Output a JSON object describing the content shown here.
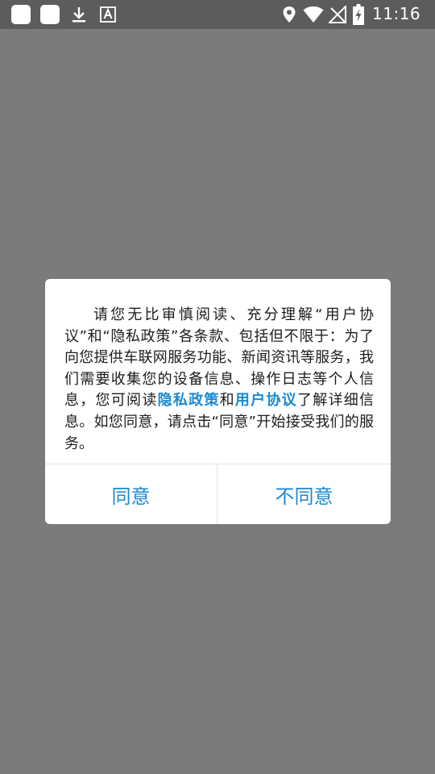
{
  "status_bar": {
    "time": "11:16",
    "notification_icons": [
      "app-square-icon",
      "app-square-icon",
      "download-icon",
      "accessibility-text-icon"
    ],
    "system_icons": [
      "location-icon",
      "wifi-icon",
      "no-signal-icon",
      "battery-charging-icon"
    ]
  },
  "dialog": {
    "body": {
      "text1": "请您无比审慎阅读、充分理解“用户协议”和“隐私政策”各条款、包括但不限于：为了向您提供车联网服务功能、新闻资讯等服务，我们需要收集您的设备信息、操作日志等个人信息，您可阅读",
      "link_privacy": "隐私政策",
      "text2": "和",
      "link_agreement": "用户协议",
      "text3": "了解详细信息。如您同意，请点击“同意”开始接受我们的服务。"
    },
    "buttons": {
      "agree": "同意",
      "disagree": "不同意"
    }
  },
  "colors": {
    "accent": "#1b8ad0",
    "overlay": "#7a7b7d",
    "status_bar": "#5b5c5e"
  }
}
